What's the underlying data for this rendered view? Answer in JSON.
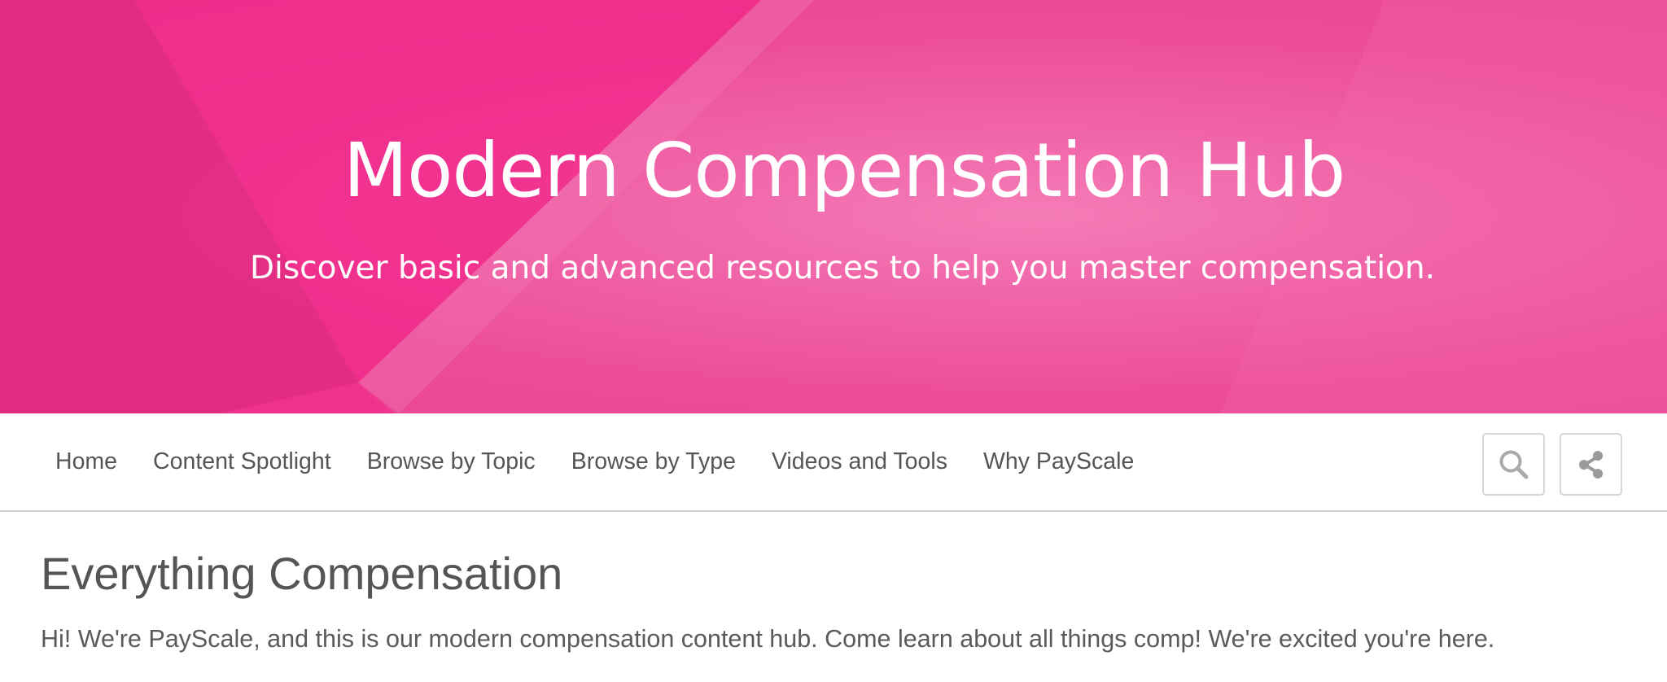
{
  "hero": {
    "title": "Modern Compensation Hub",
    "subtitle": "Discover basic and advanced resources to help you master compensation.",
    "colors": {
      "base": "#ec4d98",
      "highlight": "#f57cb7",
      "dark_panel": "#e01a7c"
    }
  },
  "nav": {
    "items": [
      {
        "label": "Home"
      },
      {
        "label": "Content Spotlight"
      },
      {
        "label": "Browse by Topic"
      },
      {
        "label": "Browse by Type"
      },
      {
        "label": "Videos and Tools"
      },
      {
        "label": "Why PayScale"
      }
    ],
    "search_icon": "search-icon",
    "share_icon": "share-icon"
  },
  "content": {
    "title": "Everything Compensation",
    "intro": "Hi! We're PayScale, and this is our modern compensation content hub. Come learn about all things comp! We're excited you're here."
  }
}
